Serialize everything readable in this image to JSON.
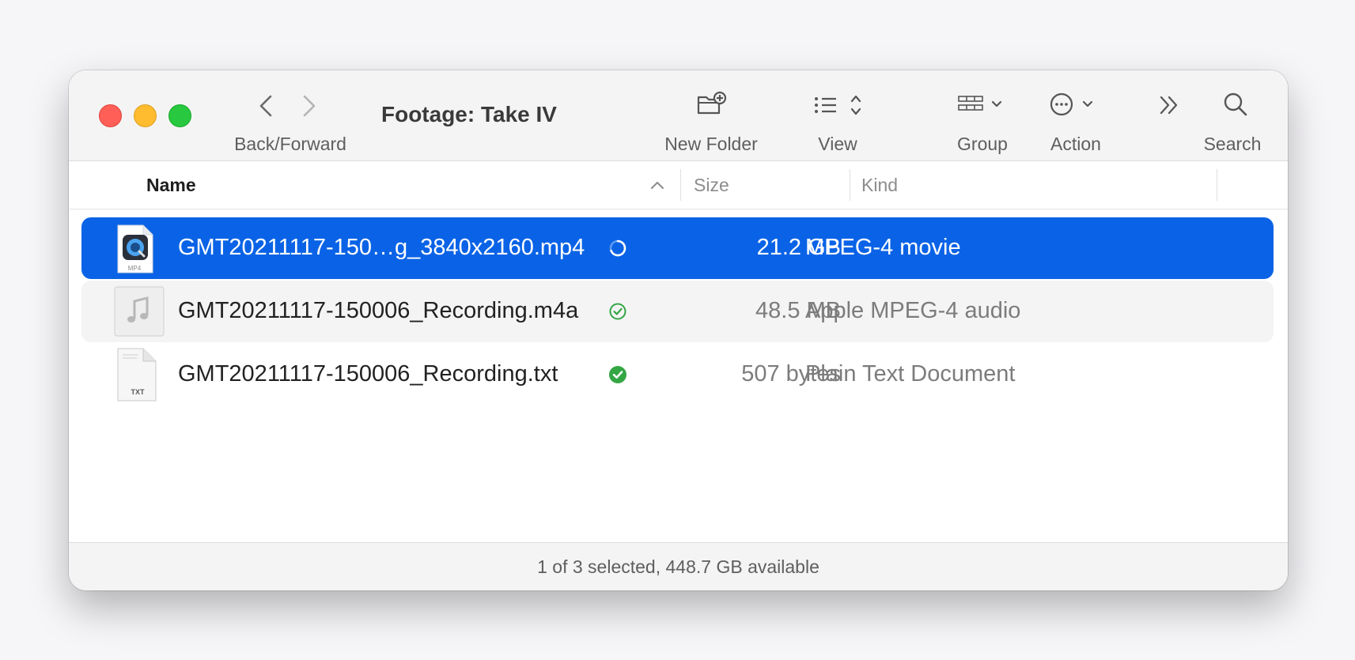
{
  "window": {
    "title": "Footage: Take IV"
  },
  "toolbar": {
    "back_forward_label": "Back/Forward",
    "new_folder_label": "New Folder",
    "view_label": "View",
    "group_label": "Group",
    "action_label": "Action",
    "search_label": "Search"
  },
  "columns": {
    "name": "Name",
    "size": "Size",
    "kind": "Kind"
  },
  "files": [
    {
      "name": "GMT20211117-150…g_3840x2160.mp4",
      "size": "21.2 GB",
      "kind": "MPEG-4 movie",
      "icon": "mp4-file-icon",
      "icon_label": "MP4",
      "status": "syncing",
      "selected": true
    },
    {
      "name": "GMT20211117-150006_Recording.m4a",
      "size": "48.5 MB",
      "kind": "Apple MPEG-4 audio",
      "icon": "audio-file-icon",
      "status": "synced-outline",
      "selected": false
    },
    {
      "name": "GMT20211117-150006_Recording.txt",
      "size": "507 bytes",
      "kind": "Plain Text Document",
      "icon": "text-file-icon",
      "icon_label": "TXT",
      "status": "synced-filled",
      "selected": false
    }
  ],
  "status_bar": {
    "text": "1 of 3 selected, 448.7 GB available"
  },
  "colors": {
    "selection": "#0a63e6",
    "close": "#ff5f57",
    "minimize": "#febc2e",
    "maximize": "#28c840",
    "synced": "#34a644"
  }
}
